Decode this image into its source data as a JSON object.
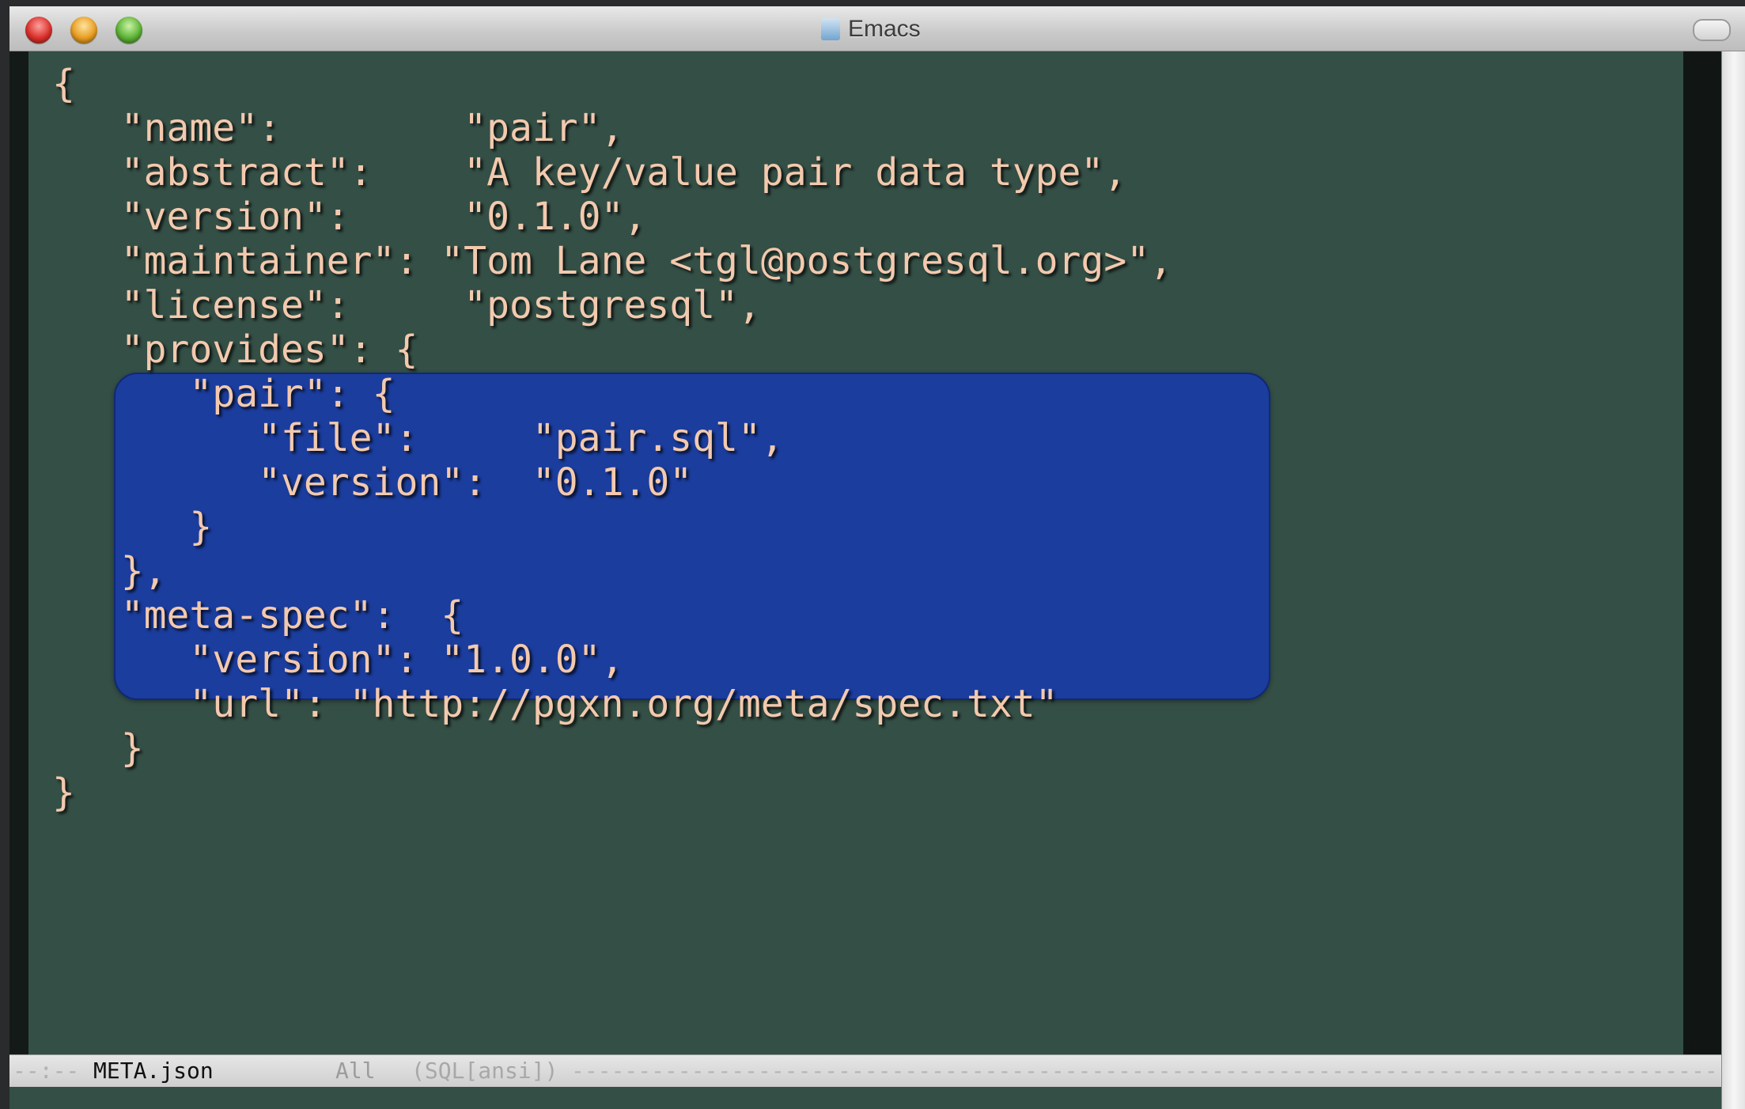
{
  "window": {
    "title": "Emacs"
  },
  "editor": {
    "lines": [
      "{",
      "   \"name\":        \"pair\",",
      "   \"abstract\":    \"A key/value pair data type\",",
      "   \"version\":     \"0.1.0\",",
      "   \"maintainer\": \"Tom Lane <tgl@postgresql.org>\",",
      "   \"license\":     \"postgresql\",",
      "   \"provides\": {",
      "      \"pair\": {",
      "         \"file\":     \"pair.sql\",",
      "         \"version\":  \"0.1.0\"",
      "      }",
      "   },",
      "   \"meta-spec\":  {",
      "      \"version\": \"1.0.0\",",
      "      \"url\": \"http://pgxn.org/meta/spec.txt\"",
      "   }",
      "}"
    ]
  },
  "modeline": {
    "status": "--:--",
    "buffer_name": "META.json",
    "position": "All",
    "mode": "(SQL[ansi])",
    "fill": "---------------------------------------------------------------------------------------------------------------------"
  },
  "colors": {
    "background": "#344f46",
    "text": "#f3c9ae",
    "region": "#1b3d9e"
  }
}
